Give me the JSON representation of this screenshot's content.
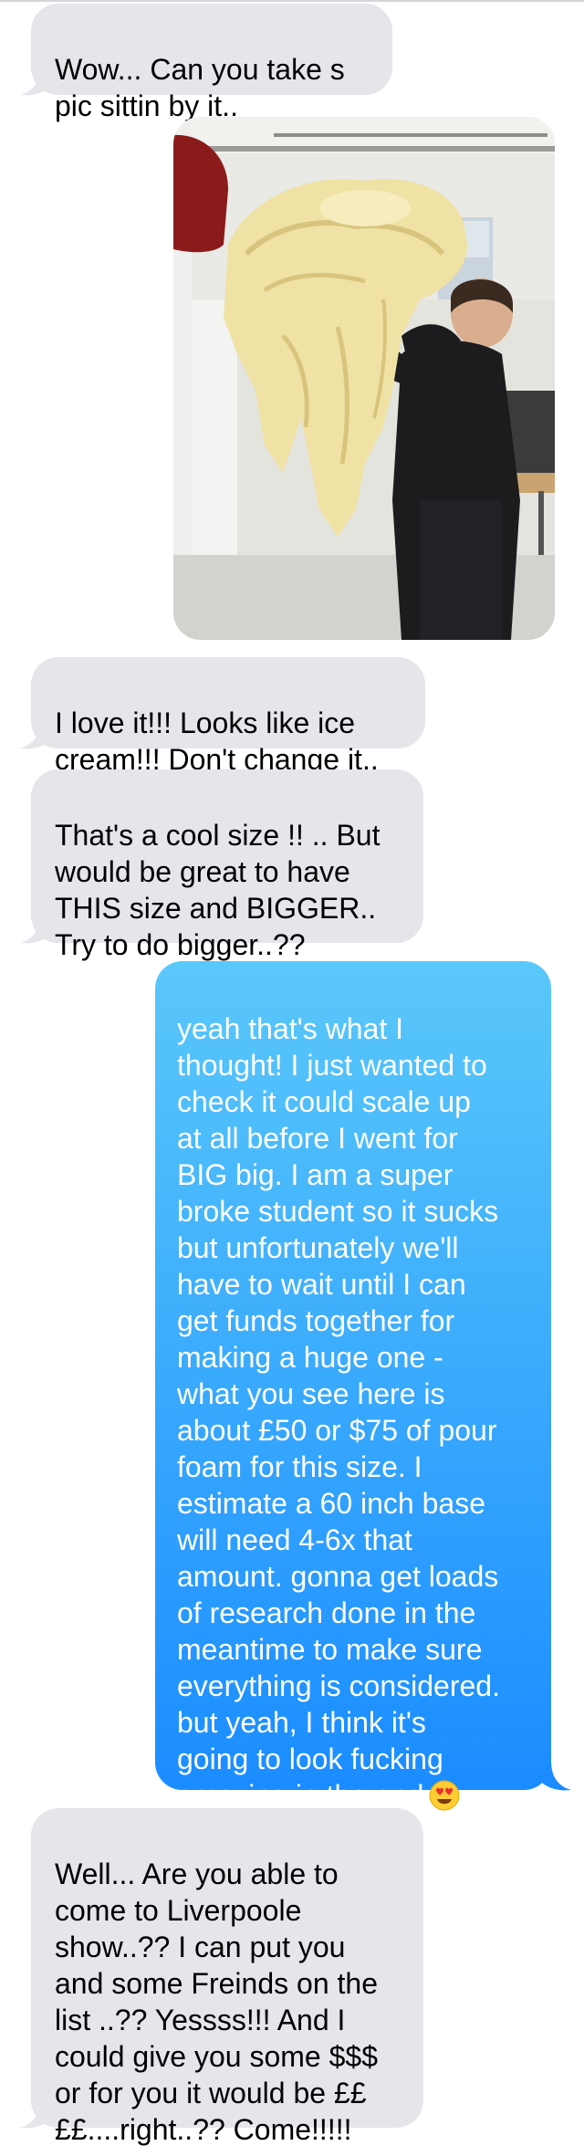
{
  "conversation": {
    "messages": [
      {
        "side": "incoming",
        "text": "Wow... Can you take s\npic sittin by it.."
      },
      {
        "side": "incoming",
        "type": "photo",
        "alt": ""
      },
      {
        "side": "incoming",
        "text": "I love it!!! Looks like ice\ncream!!! Don't change it.."
      },
      {
        "side": "incoming",
        "text": "That's a cool size !! .. But\nwould be great to have\nTHIS size and BIGGER..\nTry to do bigger..??"
      },
      {
        "side": "outgoing",
        "text": "yeah that's what I\nthought! I just wanted to\ncheck it could scale up\nat all before I went for\nBIG big. I am a super\nbroke student so it sucks\nbut unfortunately we'll\nhave to wait until I can\nget funds together for\nmaking a huge one -\nwhat you see here is\nabout £50 or $75 of pour\nfoam for this size. I\nestimate a 60 inch base\nwill need 4-6x that\namount. gonna get loads\nof research done in the\nmeantime to make sure\neverything is considered.\nbut yeah, I think it's\ngoing to look fucking\namazing in the end",
        "emoji": "heart-eyes-emoji"
      },
      {
        "side": "incoming",
        "text": "Well... Are you able to\ncome to Liverpoole\nshow..?? I can put you\nand some Freinds on the\nlist ..?? Yessss!!! And I\ncould give you some $$$\nor for you it would be ££\n££....right..?? Come!!!!!"
      }
    ]
  },
  "colors": {
    "incoming_bubble": "#e5e5ea",
    "outgoing_top": "#5ac8fa",
    "outgoing_bottom": "#1a8cff",
    "incoming_text": "#000000",
    "outgoing_text": "#ffffff"
  }
}
